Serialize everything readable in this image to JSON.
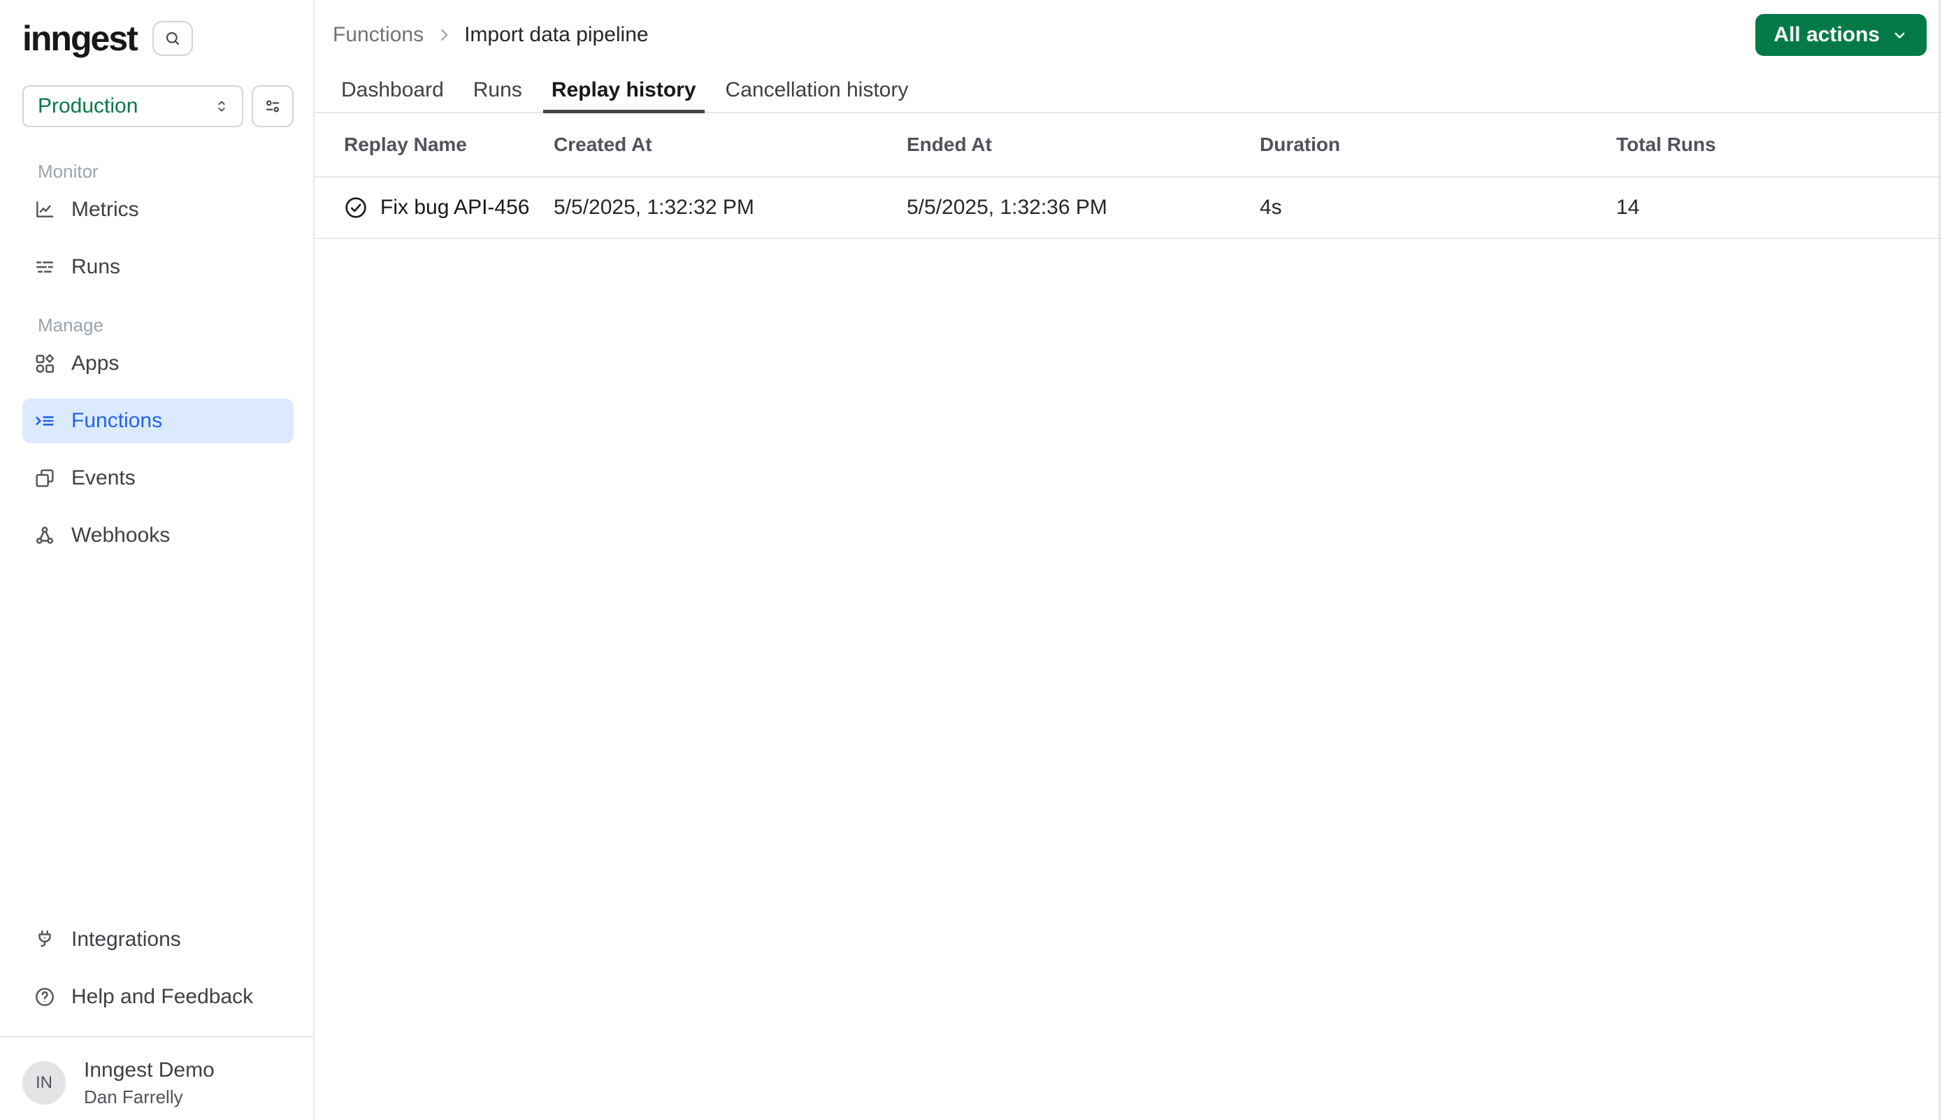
{
  "app": {
    "logo": "inngest"
  },
  "sidebar": {
    "environment": {
      "selected": "Production"
    },
    "sections": [
      {
        "label": "Monitor",
        "items": [
          {
            "label": "Metrics",
            "icon": "chart-line-icon"
          },
          {
            "label": "Runs",
            "icon": "list-dashes-icon"
          }
        ]
      },
      {
        "label": "Manage",
        "items": [
          {
            "label": "Apps",
            "icon": "apps-grid-icon"
          },
          {
            "label": "Functions",
            "icon": "function-list-icon",
            "active": true
          },
          {
            "label": "Events",
            "icon": "copy-squares-icon"
          },
          {
            "label": "Webhooks",
            "icon": "webhook-icon"
          }
        ]
      }
    ],
    "footer_items": [
      {
        "label": "Integrations",
        "icon": "plug-icon"
      },
      {
        "label": "Help and Feedback",
        "icon": "question-circle-icon"
      }
    ],
    "user": {
      "initials": "IN",
      "org": "Inngest Demo",
      "name": "Dan Farrelly"
    }
  },
  "header": {
    "breadcrumb": {
      "parent": "Functions",
      "current": "Import data pipeline"
    },
    "action_button": {
      "label": "All actions",
      "icon": "chevron-down-icon"
    }
  },
  "tabs": [
    {
      "label": "Dashboard",
      "active": false
    },
    {
      "label": "Runs",
      "active": false
    },
    {
      "label": "Replay history",
      "active": true
    },
    {
      "label": "Cancellation history",
      "active": false
    }
  ],
  "table": {
    "columns": [
      "Replay Name",
      "Created At",
      "Ended At",
      "Duration",
      "Total Runs"
    ],
    "rows": [
      {
        "status_icon": "check-circle-icon",
        "name": "Fix bug API-456",
        "created_at": "5/5/2025, 1:32:32 PM",
        "ended_at": "5/5/2025, 1:32:36 PM",
        "duration": "4s",
        "total_runs": "14"
      }
    ]
  },
  "colors": {
    "accent_green": "#027a48",
    "active_blue": "#2563eb",
    "active_blue_bg": "#dbeafe",
    "border": "#e7e7e8",
    "text_dark": "#1c1c1e",
    "text_muted": "#9ca3af"
  }
}
